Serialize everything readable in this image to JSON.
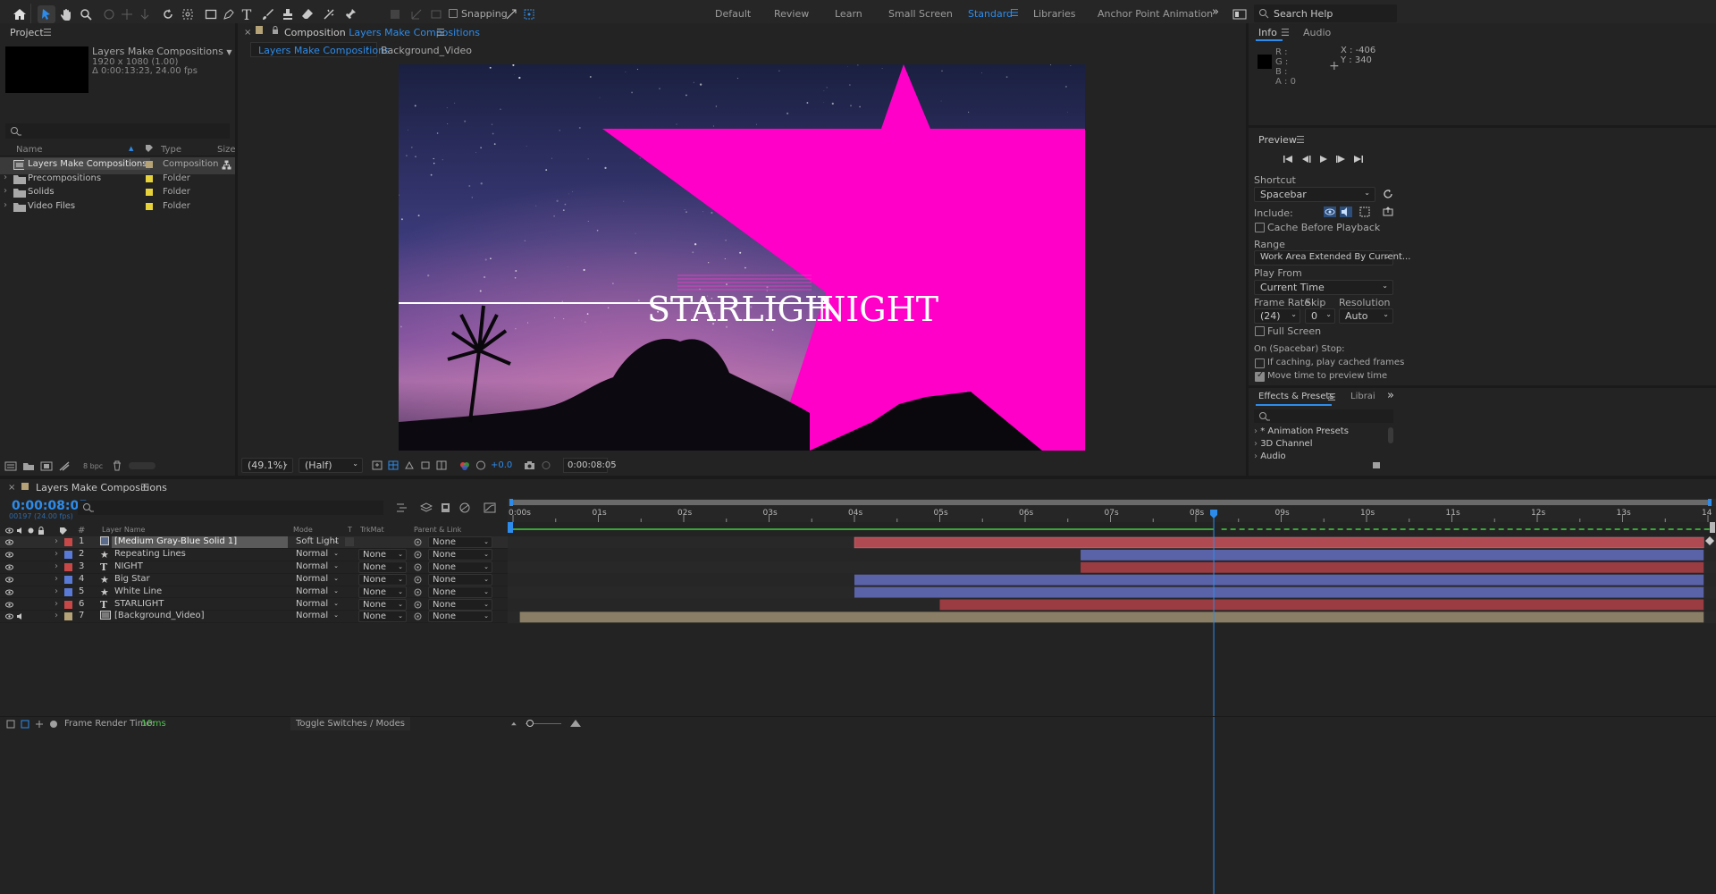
{
  "toolbar": {
    "snapping_label": "Snapping",
    "workspaces": [
      "Default",
      "Review",
      "Learn",
      "Small Screen",
      "Standard",
      "Libraries",
      "Anchor Point Animation"
    ],
    "active_workspace": "Standard",
    "search_placeholder": "Search Help"
  },
  "project": {
    "title": "Project",
    "comp_name": "Layers Make Compositions",
    "comp_size": "1920 x 1080 (1.00)",
    "comp_duration": "Δ 0:00:13:23, 24.00 fps",
    "columns": {
      "name": "Name",
      "type": "Type",
      "size": "Size"
    },
    "items": [
      {
        "name": "Layers Make Compositions",
        "type": "Composition",
        "icon": "composition-icon",
        "color": "#b5a276"
      },
      {
        "name": "Precompositions",
        "type": "Folder",
        "icon": "folder-icon",
        "color": "#e6d23a"
      },
      {
        "name": "Solids",
        "type": "Folder",
        "icon": "folder-icon",
        "color": "#e6d23a"
      },
      {
        "name": "Video Files",
        "type": "Folder",
        "icon": "folder-icon",
        "color": "#e6d23a"
      }
    ],
    "bpc": "8 bpc"
  },
  "composition": {
    "tab_prefix": "Composition",
    "tab_name": "Layers Make Compositions",
    "breadcrumbs": [
      "Layers Make Compositions",
      "Background_Video"
    ],
    "viewer_text_left": "STARLIGH",
    "viewer_text_right": "NIGHT",
    "zoom": "(49.1%)",
    "resolution": "(Half)",
    "exposure": "+0.0",
    "timecode": "0:00:08:05",
    "star_color": "#ff00c8"
  },
  "info": {
    "tabs": [
      "Info",
      "Audio"
    ],
    "r": "R :",
    "g": "G :",
    "b": "B :",
    "a": "A : 0",
    "x": "X : -406",
    "y": "Y : 340"
  },
  "preview": {
    "title": "Preview",
    "shortcut_label": "Shortcut",
    "shortcut_value": "Spacebar",
    "include_label": "Include:",
    "cache_label": "Cache Before Playback",
    "range_label": "Range",
    "range_value": "Work Area Extended By Current...",
    "play_from_label": "Play From",
    "play_from_value": "Current Time",
    "frame_rate_label": "Frame Rate",
    "skip_label": "Skip",
    "resolution_label": "Resolution",
    "frame_rate_value": "(24)",
    "skip_value": "0",
    "resolution_value": "Auto",
    "full_screen_label": "Full Screen",
    "stop_label": "On (Spacebar) Stop:",
    "if_caching_label": "If caching, play cached frames",
    "move_time_label": "Move time to preview time"
  },
  "effects": {
    "tabs": [
      "Effects & Presets",
      "Librai"
    ],
    "items": [
      "* Animation Presets",
      "3D Channel",
      "Audio"
    ]
  },
  "timeline": {
    "comp_tab": "Layers Make Compositions",
    "current_time": "0:00:08:05",
    "frame_info": "00197 (24.00 fps)",
    "columns": {
      "num": "#",
      "layer_name": "Layer Name",
      "mode": "Mode",
      "t": "T",
      "trkmat": "TrkMat",
      "parent": "Parent & Link"
    },
    "ruler": [
      "0:00s",
      "01s",
      "02s",
      "03s",
      "04s",
      "05s",
      "06s",
      "07s",
      "08s",
      "09s",
      "10s",
      "11s",
      "12s",
      "13s",
      "14"
    ],
    "duration_seconds": 14,
    "playhead_seconds": 8.21,
    "layers": [
      {
        "num": "1",
        "name": "[Medium Gray-Blue Solid 1]",
        "mode": "Soft Light",
        "trkmat": "",
        "parent": "None",
        "label_color": "#c84848",
        "icon": "solid-icon",
        "bar_color": "#b04a52",
        "start": 4.0,
        "end": 13.95
      },
      {
        "num": "2",
        "name": "Repeating Lines",
        "mode": "Normal",
        "trkmat": "None",
        "parent": "None",
        "label_color": "#5a7ad8",
        "icon": "star-shape-icon",
        "bar_color": "#5a63a8",
        "start": 6.65,
        "end": 13.95
      },
      {
        "num": "3",
        "name": "NIGHT",
        "mode": "Normal",
        "trkmat": "None",
        "parent": "None",
        "label_color": "#c84848",
        "icon": "text-layer-icon",
        "bar_color": "#9a3c42",
        "start": 6.65,
        "end": 13.95
      },
      {
        "num": "4",
        "name": "Big Star",
        "mode": "Normal",
        "trkmat": "None",
        "parent": "None",
        "label_color": "#5a7ad8",
        "icon": "star-shape-icon",
        "bar_color": "#5a63a8",
        "start": 4.0,
        "end": 13.95
      },
      {
        "num": "5",
        "name": "White Line",
        "mode": "Normal",
        "trkmat": "None",
        "parent": "None",
        "label_color": "#5a7ad8",
        "icon": "star-shape-icon",
        "bar_color": "#5a63a8",
        "start": 4.0,
        "end": 13.95
      },
      {
        "num": "6",
        "name": "STARLIGHT",
        "mode": "Normal",
        "trkmat": "None",
        "parent": "None",
        "label_color": "#c84848",
        "icon": "text-layer-icon",
        "bar_color": "#9a3c42",
        "start": 5.0,
        "end": 13.95
      },
      {
        "num": "7",
        "name": "[Background_Video]",
        "mode": "Normal",
        "trkmat": "None",
        "parent": "None",
        "label_color": "#b5a276",
        "icon": "footage-icon",
        "bar_color": "#8a7f66",
        "start": 0.08,
        "end": 13.95
      }
    ],
    "frame_render_label": "Frame Render Time:",
    "frame_render_value": "10ms",
    "toggle_label": "Toggle Switches / Modes"
  }
}
